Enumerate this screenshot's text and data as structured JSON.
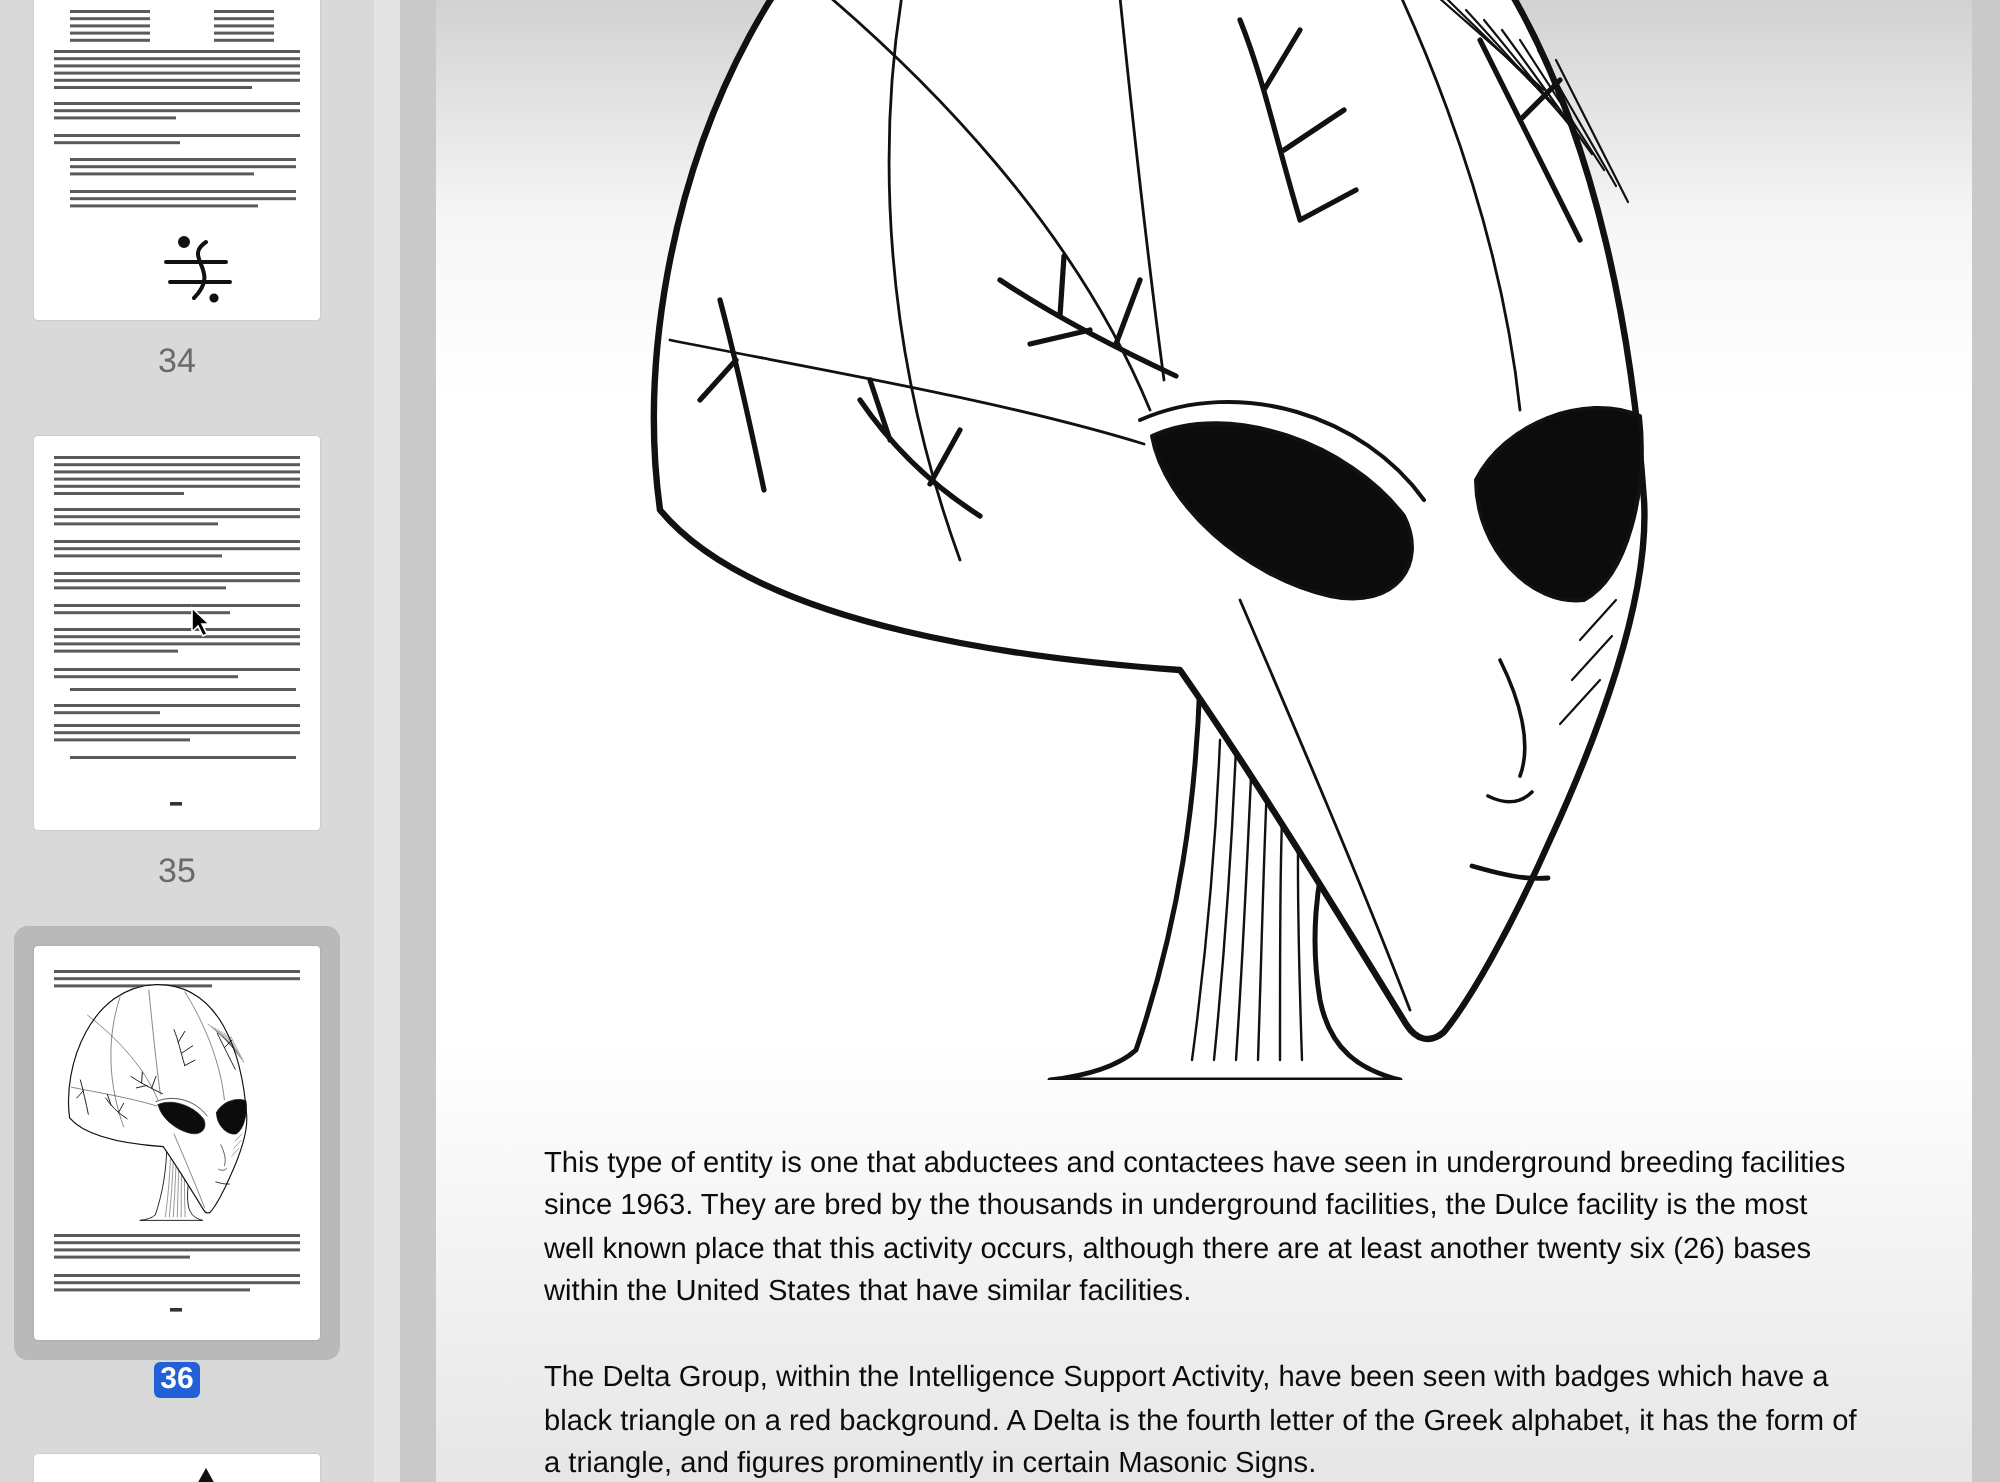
{
  "sidebar": {
    "thumbnails": [
      {
        "kind": "diagram",
        "page": "34",
        "selected": false,
        "pointer_over": false
      },
      {
        "kind": "text",
        "page": "35",
        "selected": false,
        "pointer_over": true
      },
      {
        "kind": "illustration",
        "page": "36",
        "selected": true,
        "pointer_over": false
      },
      {
        "kind": "mark",
        "selected": false,
        "pointer_over": false
      }
    ]
  },
  "document": {
    "paragraphs": [
      "This type of entity is one that abductees and contactees have seen in underground breeding facilities since 1963. They are bred by the thousands in underground facilities, the Dulce facility is the most well known place that this activity occurs, although there are at least another twenty six (26) bases within the United States that have similar facilities.",
      "The Delta Group, within the Intelligence Support Activity, have been seen with badges which have a black triangle on a red background. A Delta is the fourth letter of the Greek alphabet, it has the form of a triangle, and figures prominently in certain Masonic Signs."
    ]
  }
}
